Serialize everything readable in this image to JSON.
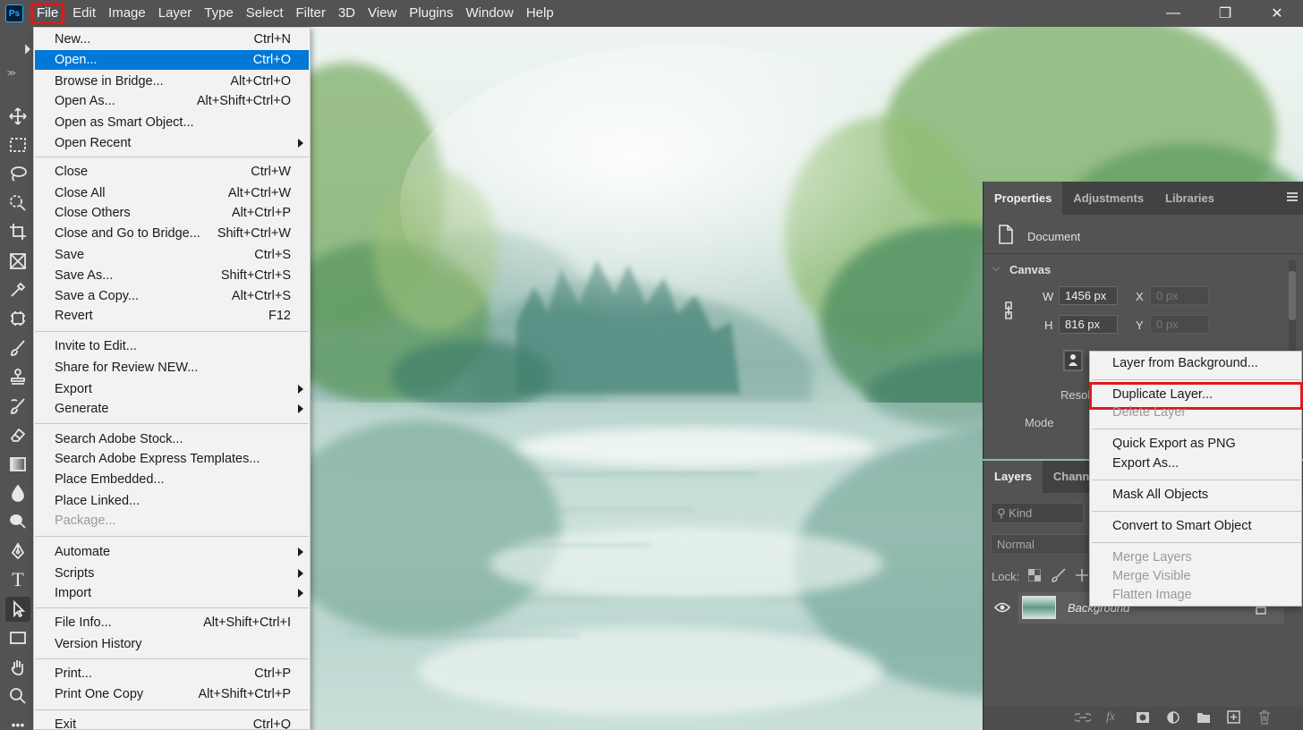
{
  "app": {
    "logo_text": "Ps"
  },
  "menubar": {
    "items": [
      "File",
      "Edit",
      "Image",
      "Layer",
      "Type",
      "Select",
      "Filter",
      "3D",
      "View",
      "Plugins",
      "Window",
      "Help"
    ],
    "active_item": "File"
  },
  "window_controls": {
    "minimize": "—",
    "maximize": "❐",
    "close": "✕"
  },
  "file_menu": {
    "items": [
      {
        "label": "New...",
        "shortcut": "Ctrl+N"
      },
      {
        "label": "Open...",
        "shortcut": "Ctrl+O",
        "highlighted": true
      },
      {
        "label": "Browse in Bridge...",
        "shortcut": "Alt+Ctrl+O"
      },
      {
        "label": "Open As...",
        "shortcut": "Alt+Shift+Ctrl+O"
      },
      {
        "label": "Open as Smart Object...",
        "shortcut": ""
      },
      {
        "label": "Open Recent",
        "shortcut": "",
        "submenu": true
      },
      {
        "label": "Close",
        "shortcut": "Ctrl+W"
      },
      {
        "label": "Close All",
        "shortcut": "Alt+Ctrl+W"
      },
      {
        "label": "Close Others",
        "shortcut": "Alt+Ctrl+P"
      },
      {
        "label": "Close and Go to Bridge...",
        "shortcut": "Shift+Ctrl+W"
      },
      {
        "label": "Save",
        "shortcut": "Ctrl+S"
      },
      {
        "label": "Save As...",
        "shortcut": "Shift+Ctrl+S"
      },
      {
        "label": "Save a Copy...",
        "shortcut": "Alt+Ctrl+S"
      },
      {
        "label": "Revert",
        "shortcut": "F12"
      },
      {
        "label": "Invite to Edit...",
        "shortcut": ""
      },
      {
        "label": "Share for Review NEW...",
        "shortcut": ""
      },
      {
        "label": "Export",
        "shortcut": "",
        "submenu": true
      },
      {
        "label": "Generate",
        "shortcut": "",
        "submenu": true
      },
      {
        "label": "Search Adobe Stock...",
        "shortcut": ""
      },
      {
        "label": "Search Adobe Express Templates...",
        "shortcut": ""
      },
      {
        "label": "Place Embedded...",
        "shortcut": ""
      },
      {
        "label": "Place Linked...",
        "shortcut": ""
      },
      {
        "label": "Package...",
        "shortcut": "",
        "disabled": true
      },
      {
        "label": "Automate",
        "shortcut": "",
        "submenu": true
      },
      {
        "label": "Scripts",
        "shortcut": "",
        "submenu": true
      },
      {
        "label": "Import",
        "shortcut": "",
        "submenu": true
      },
      {
        "label": "File Info...",
        "shortcut": "Alt+Shift+Ctrl+I"
      },
      {
        "label": "Version History",
        "shortcut": ""
      },
      {
        "label": "Print...",
        "shortcut": "Ctrl+P"
      },
      {
        "label": "Print One Copy",
        "shortcut": "Alt+Shift+Ctrl+P"
      },
      {
        "label": "Exit",
        "shortcut": "Ctrl+Q"
      }
    ]
  },
  "properties_panel": {
    "tabs": [
      "Properties",
      "Adjustments",
      "Libraries"
    ],
    "active_tab": "Properties",
    "document_label": "Document",
    "canvas_section": "Canvas",
    "width_label": "W",
    "width_value": "1456 px",
    "height_label": "H",
    "height_value": "816 px",
    "x_label": "X",
    "x_placeholder": "0 px",
    "y_label": "Y",
    "y_placeholder": "0 px",
    "resolution_label": "Resol",
    "mode_label": "Mode"
  },
  "layers_panel": {
    "tabs": [
      "Layers",
      "Channel"
    ],
    "active_tab": "Layers",
    "kind_placeholder": "Kind",
    "blend_mode": "Normal",
    "lock_label": "Lock:",
    "layers": [
      {
        "name": "Background",
        "visible": true
      }
    ]
  },
  "context_menu": {
    "items": [
      {
        "label": "Layer from Background...",
        "disabled": false
      },
      {
        "label": "Duplicate Layer...",
        "disabled": false,
        "highlighted": true
      },
      {
        "label": "Delete Layer",
        "disabled": true
      },
      {
        "label": "Quick Export as PNG",
        "disabled": false
      },
      {
        "label": "Export As...",
        "disabled": false
      },
      {
        "label": "Mask All Objects",
        "disabled": false
      },
      {
        "label": "Convert to Smart Object",
        "disabled": false
      },
      {
        "label": "Merge Layers",
        "disabled": true
      },
      {
        "label": "Merge Visible",
        "disabled": true
      },
      {
        "label": "Flatten Image",
        "disabled": true
      }
    ]
  },
  "colors": {
    "highlight_blue": "#0078d7",
    "annotation_red": "#e0191b",
    "panel_bg": "#535353",
    "menu_bg": "#f2f2f2"
  }
}
